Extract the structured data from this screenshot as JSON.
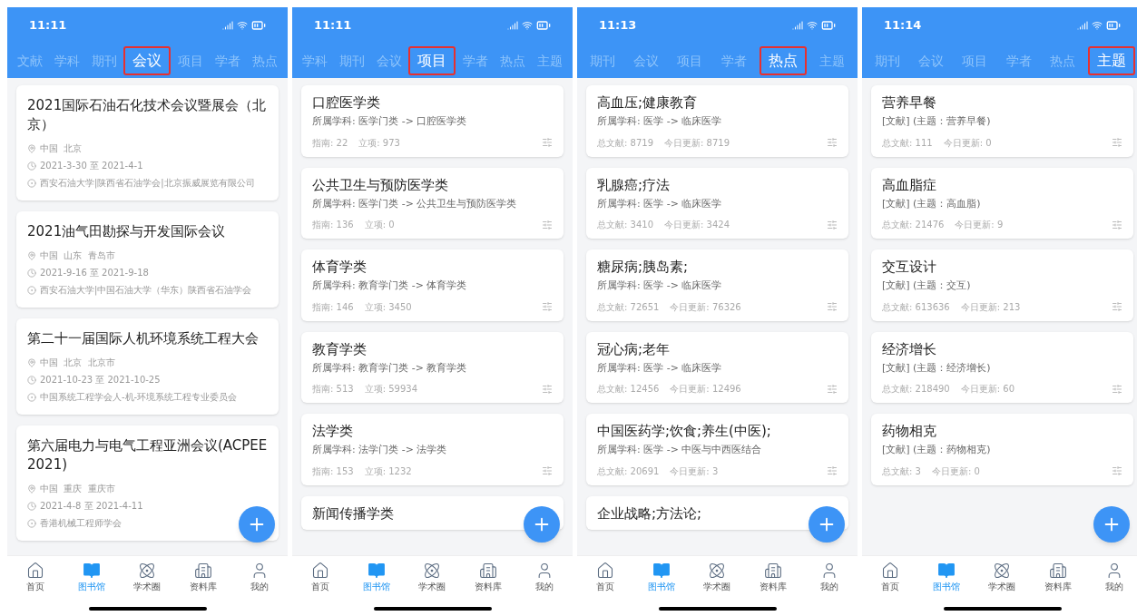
{
  "screens": [
    {
      "time": "11:11",
      "tabs": [
        {
          "label": "文献",
          "selected": false
        },
        {
          "label": "学科",
          "selected": false
        },
        {
          "label": "期刊",
          "selected": false
        },
        {
          "label": "会议",
          "selected": true
        },
        {
          "label": "项目",
          "selected": false
        },
        {
          "label": "学者",
          "selected": false
        },
        {
          "label": "热点",
          "selected": false
        }
      ],
      "cards": [
        {
          "kind": "conference",
          "title": "2021国际石油石化技术会议暨展会（北京）",
          "location": "中国  北京",
          "dates": "2021-3-30 至 2021-4-1",
          "organizer": "西安石油大学|陕西省石油学会|北京振威展览有限公司"
        },
        {
          "kind": "conference",
          "title": "2021油气田勘探与开发国际会议",
          "location": "中国  山东  青岛市",
          "dates": "2021-9-16 至 2021-9-18",
          "organizer": "西安石油大学|中国石油大学（华东）陕西省石油学会"
        },
        {
          "kind": "conference",
          "title": "第二十一届国际人机环境系统工程大会",
          "location": "中国  北京  北京市",
          "dates": "2021-10-23 至 2021-10-25",
          "organizer": "中国系统工程学会人-机-环境系统工程专业委员会"
        },
        {
          "kind": "conference",
          "title": "第六届电力与电气工程亚洲会议(ACPEE 2021)",
          "location": "中国  重庆  重庆市",
          "dates": "2021-4-8 至 2021-4-11",
          "organizer": "香港机械工程师学会"
        }
      ],
      "nav": [
        {
          "label": "首页",
          "selected": false
        },
        {
          "label": "图书馆",
          "selected": true
        },
        {
          "label": "学术圈",
          "selected": false
        },
        {
          "label": "资料库",
          "selected": false
        },
        {
          "label": "我的",
          "selected": false
        }
      ]
    },
    {
      "time": "11:11",
      "tabs": [
        {
          "label": "学科",
          "selected": false
        },
        {
          "label": "期刊",
          "selected": false
        },
        {
          "label": "会议",
          "selected": false
        },
        {
          "label": "项目",
          "selected": true
        },
        {
          "label": "学者",
          "selected": false
        },
        {
          "label": "热点",
          "selected": false
        },
        {
          "label": "主题",
          "selected": false
        }
      ],
      "cards": [
        {
          "kind": "stats",
          "title": "口腔医学类",
          "subtitle": "所属学科: 医学门类 -> 口腔医学类",
          "stats": [
            "指南: 22",
            "立项: 973"
          ]
        },
        {
          "kind": "stats",
          "title": "公共卫生与预防医学类",
          "subtitle": "所属学科: 医学门类 -> 公共卫生与预防医学类",
          "stats": [
            "指南: 136",
            "立项: 0"
          ]
        },
        {
          "kind": "stats",
          "title": "体育学类",
          "subtitle": "所属学科: 教育学门类 -> 体育学类",
          "stats": [
            "指南: 146",
            "立项: 3450"
          ]
        },
        {
          "kind": "stats",
          "title": "教育学类",
          "subtitle": "所属学科: 教育学门类 -> 教育学类",
          "stats": [
            "指南: 513",
            "立项: 59934"
          ]
        },
        {
          "kind": "stats",
          "title": "法学类",
          "subtitle": "所属学科: 法学门类 -> 法学类",
          "stats": [
            "指南: 153",
            "立项: 1232"
          ]
        },
        {
          "kind": "stats",
          "title": "新闻传播学类"
        }
      ],
      "nav": [
        {
          "label": "首页",
          "selected": false
        },
        {
          "label": "图书馆",
          "selected": true
        },
        {
          "label": "学术圈",
          "selected": false
        },
        {
          "label": "资料库",
          "selected": false
        },
        {
          "label": "我的",
          "selected": false
        }
      ]
    },
    {
      "time": "11:13",
      "tabs": [
        {
          "label": "期刊",
          "selected": false
        },
        {
          "label": "会议",
          "selected": false
        },
        {
          "label": "项目",
          "selected": false
        },
        {
          "label": "学者",
          "selected": false
        },
        {
          "label": "热点",
          "selected": true
        },
        {
          "label": "主题",
          "selected": false
        }
      ],
      "cards": [
        {
          "kind": "stats",
          "title": "高血压;健康教育",
          "subtitle": "所属学科: 医学 -> 临床医学",
          "stats": [
            "总文献: 8719",
            "今日更新: 8719"
          ]
        },
        {
          "kind": "stats",
          "title": "乳腺癌;疗法",
          "subtitle": "所属学科: 医学 -> 临床医学",
          "stats": [
            "总文献: 3410",
            "今日更新: 3424"
          ]
        },
        {
          "kind": "stats",
          "title": "糖尿病;胰岛素;",
          "subtitle": "所属学科: 医学 -> 临床医学",
          "stats": [
            "总文献: 72651",
            "今日更新: 76326"
          ]
        },
        {
          "kind": "stats",
          "title": "冠心病;老年",
          "subtitle": "所属学科: 医学 -> 临床医学",
          "stats": [
            "总文献: 12456",
            "今日更新: 12496"
          ]
        },
        {
          "kind": "stats",
          "title": "中国医药学;饮食;养生(中医);",
          "subtitle": "所属学科: 医学 -> 中医与中西医结合",
          "stats": [
            "总文献: 20691",
            "今日更新: 3"
          ]
        },
        {
          "kind": "stats",
          "title": "企业战略;方法论;"
        }
      ],
      "nav": [
        {
          "label": "首页",
          "selected": false
        },
        {
          "label": "图书馆",
          "selected": true
        },
        {
          "label": "学术圈",
          "selected": false
        },
        {
          "label": "资料库",
          "selected": false
        },
        {
          "label": "我的",
          "selected": false
        }
      ]
    },
    {
      "time": "11:14",
      "tabs": [
        {
          "label": "期刊",
          "selected": false
        },
        {
          "label": "会议",
          "selected": false
        },
        {
          "label": "项目",
          "selected": false
        },
        {
          "label": "学者",
          "selected": false
        },
        {
          "label": "热点",
          "selected": false
        },
        {
          "label": "主题",
          "selected": true
        }
      ],
      "cards": [
        {
          "kind": "stats",
          "title": "营养早餐",
          "subtitle": "[文献] (主题：营养早餐)",
          "stats": [
            "总文献: 111",
            "今日更新: 0"
          ]
        },
        {
          "kind": "stats",
          "title": "高血脂症",
          "subtitle": "[文献] (主题：高血脂)",
          "stats": [
            "总文献: 21476",
            "今日更新: 9"
          ]
        },
        {
          "kind": "stats",
          "title": "交互设计",
          "subtitle": "[文献] (主题：交互)",
          "stats": [
            "总文献: 613636",
            "今日更新: 213"
          ]
        },
        {
          "kind": "stats",
          "title": "经济增长",
          "subtitle": "[文献] (主题：经济增长)",
          "stats": [
            "总文献: 218490",
            "今日更新: 60"
          ]
        },
        {
          "kind": "stats",
          "title": "药物相克",
          "subtitle": "[文献] (主题：药物相克)",
          "stats": [
            "总文献: 3",
            "今日更新: 0"
          ]
        }
      ],
      "nav": [
        {
          "label": "首页",
          "selected": false
        },
        {
          "label": "图书馆",
          "selected": true
        },
        {
          "label": "学术圈",
          "selected": false
        },
        {
          "label": "资料库",
          "selected": false
        },
        {
          "label": "我的",
          "selected": false
        }
      ]
    }
  ]
}
